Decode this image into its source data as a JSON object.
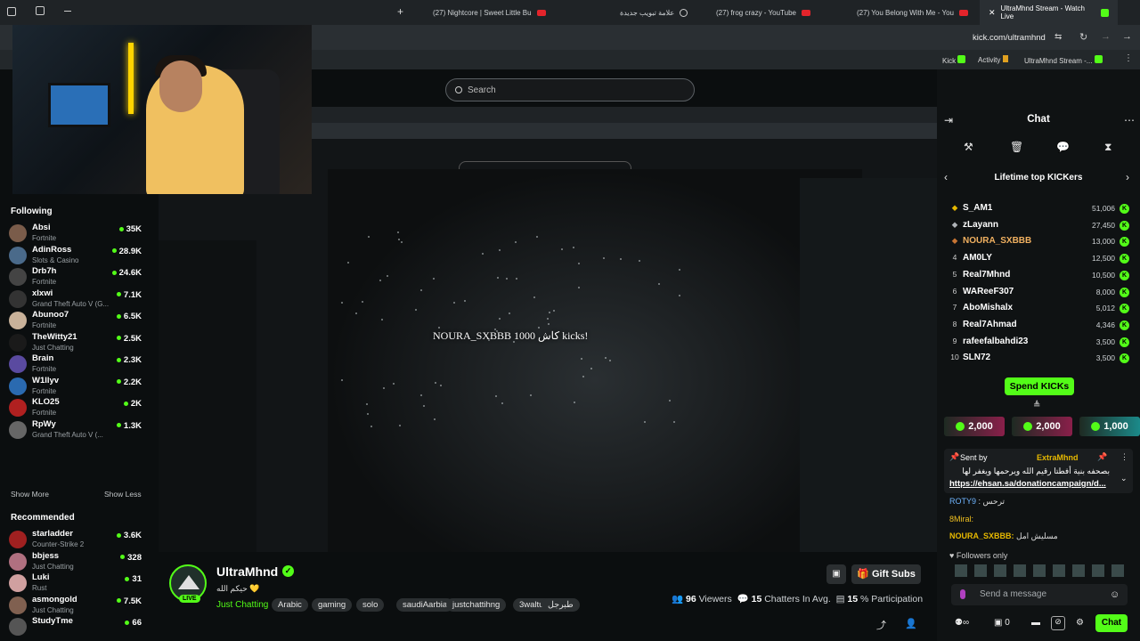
{
  "browser": {
    "tabs": [
      {
        "label": "(27) Nightcore | Sweet Little Bu"
      },
      {
        "label": "علامة تبويب جديدة"
      },
      {
        "label": "(27) frog crazy - YouTube"
      },
      {
        "label": "(27) You Belong With Me - You"
      },
      {
        "label": "UltraMhnd Stream - Watch Live"
      }
    ],
    "url": "kick.com/ultramhnd",
    "bookmarks": [
      "Kick",
      "Activity",
      "UltraMhnd Stream -..."
    ]
  },
  "search": {
    "placeholder": "Search"
  },
  "sidebar": {
    "following_title": "Following",
    "following": [
      {
        "name": "Absi",
        "game": "Fortnite",
        "viewers": "35K",
        "color": "#7a5c4a"
      },
      {
        "name": "AdinRoss",
        "game": "Slots & Casino",
        "viewers": "28.9K",
        "color": "#4a6a8a"
      },
      {
        "name": "Drb7h",
        "game": "Fortnite",
        "viewers": "24.6K",
        "color": "#444"
      },
      {
        "name": "xIxwi",
        "game": "Grand Theft Auto V (G...",
        "viewers": "7.1K",
        "color": "#333"
      },
      {
        "name": "Abunoo7",
        "game": "Fortnite",
        "viewers": "6.5K",
        "color": "#c9b29a"
      },
      {
        "name": "TheWitty21",
        "game": "Just Chatting",
        "viewers": "2.5K",
        "color": "#1a1a1a"
      },
      {
        "name": "Brain",
        "game": "Fortnite",
        "viewers": "2.3K",
        "color": "#5a4aa0"
      },
      {
        "name": "W1llyv",
        "game": "Fortnite",
        "viewers": "2.2K",
        "color": "#2a6ab0"
      },
      {
        "name": "KLO25",
        "game": "Fortnite",
        "viewers": "2K",
        "color": "#b02020"
      },
      {
        "name": "RpWy",
        "game": "Grand Theft Auto V (...",
        "viewers": "1.3K",
        "color": "#666"
      }
    ],
    "show_more": "Show More",
    "show_less": "Show Less",
    "recommended_title": "Recommended",
    "recommended": [
      {
        "name": "starladder",
        "game": "Counter-Strike 2",
        "viewers": "3.6K",
        "color": "#a02020"
      },
      {
        "name": "bbjess",
        "game": "Just Chatting",
        "viewers": "328",
        "color": "#b07080"
      },
      {
        "name": "Luki",
        "game": "Rust",
        "viewers": "31",
        "color": "#d0a0a0"
      },
      {
        "name": "asmongold",
        "game": "Just Chatting",
        "viewers": "7.5K",
        "color": "#806050"
      },
      {
        "name": "StudyTme",
        "game": "",
        "viewers": "66",
        "color": "#555"
      }
    ]
  },
  "stream": {
    "overlay_text": "NOURA_SXBBB كاش 1000 kicks!",
    "name": "UltraMhnd",
    "live": "LIVE",
    "bio": "حيكم الله 💛",
    "category": "Just Chatting",
    "tags": [
      "Arabic",
      "gaming",
      "solo",
      "saudiAarbia",
      "justchattihng",
      "3waltubrjal",
      "طبرجل"
    ],
    "gift_subs": "Gift Subs",
    "viewers": "96",
    "viewers_label": "Viewers",
    "chatters": "15",
    "chatters_label": "Chatters In Avg.",
    "participation": "15",
    "participation_label": "% Participation"
  },
  "chat": {
    "title": "Chat",
    "leaderboard_title": "Lifetime top KICKers",
    "leaders": [
      {
        "rank": "",
        "name": "S_AM1",
        "amount": "51,006",
        "medal": "#e6b800"
      },
      {
        "rank": "",
        "name": "zLayann",
        "amount": "27,450",
        "medal": "#b0b4b8"
      },
      {
        "rank": "",
        "name": "NOURA_SXBBB",
        "amount": "13,000",
        "medal": "#c87533"
      },
      {
        "rank": "4",
        "name": "AM0LY",
        "amount": "12,500"
      },
      {
        "rank": "5",
        "name": "Real7Mhnd",
        "amount": "10,500"
      },
      {
        "rank": "6",
        "name": "WAReeF307",
        "amount": "8,000"
      },
      {
        "rank": "7",
        "name": "AboMishalx",
        "amount": "5,012"
      },
      {
        "rank": "8",
        "name": "Real7Ahmad",
        "amount": "4,346"
      },
      {
        "rank": "9",
        "name": "rafeefalbahdi23",
        "amount": "3,500"
      },
      {
        "rank": "10",
        "name": "SLN72",
        "amount": "3,500"
      }
    ],
    "spend_label": "Spend KICKs",
    "kick_chips": [
      {
        "amount": "2,000",
        "color": "#8a1f4a"
      },
      {
        "amount": "2,000",
        "color": "#8a1f4a"
      },
      {
        "amount": "1,000",
        "color": "#1b8a8a"
      }
    ],
    "pinned": {
      "sent_by": "Sent by",
      "sender": "ExtraMhnd",
      "text": "بصحفه بنية أفطتا رقيم الله ويرحمها ويغفر لها",
      "link": "https://ehsan.sa/donationcampaign/d..."
    },
    "messages": [
      {
        "user": "ROTY9",
        "text": "ترحس"
      },
      {
        "user": "8Miral:",
        "text": ""
      },
      {
        "user": "NOURA_SXBBB:",
        "text": "مسليش امل"
      }
    ],
    "followers_only": "Followers only",
    "send_placeholder": "Send a message",
    "kicks_count": "0",
    "chat_button": "Chat"
  }
}
